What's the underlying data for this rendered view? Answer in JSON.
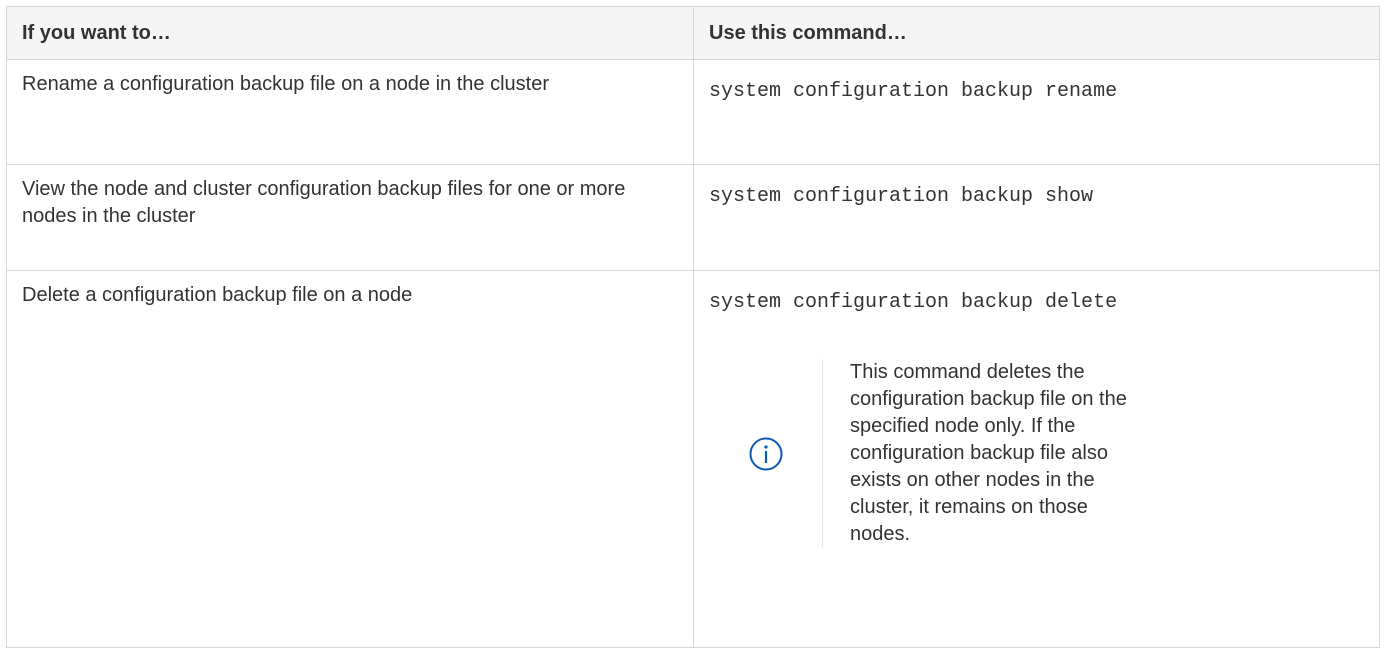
{
  "table": {
    "headers": {
      "col1": "If you want to…",
      "col2": "Use this command…"
    },
    "rows": [
      {
        "description": "Rename a configuration backup file on a node in the cluster",
        "command": "system configuration backup rename"
      },
      {
        "description": "View the node and cluster configuration backup files for one or more nodes in the cluster",
        "command": "system configuration backup show"
      },
      {
        "description": "Delete a configuration backup file on a node",
        "command": "system configuration backup delete",
        "note": {
          "icon": "info-icon",
          "text": "This command deletes the configuration backup file on the specified node only. If the configuration backup file also exists on other nodes in the cluster, it remains on those nodes."
        }
      }
    ]
  },
  "colors": {
    "border": "#d6d6d6",
    "header_bg": "#f5f5f5",
    "text": "#333333",
    "icon": "#0a59b5"
  }
}
